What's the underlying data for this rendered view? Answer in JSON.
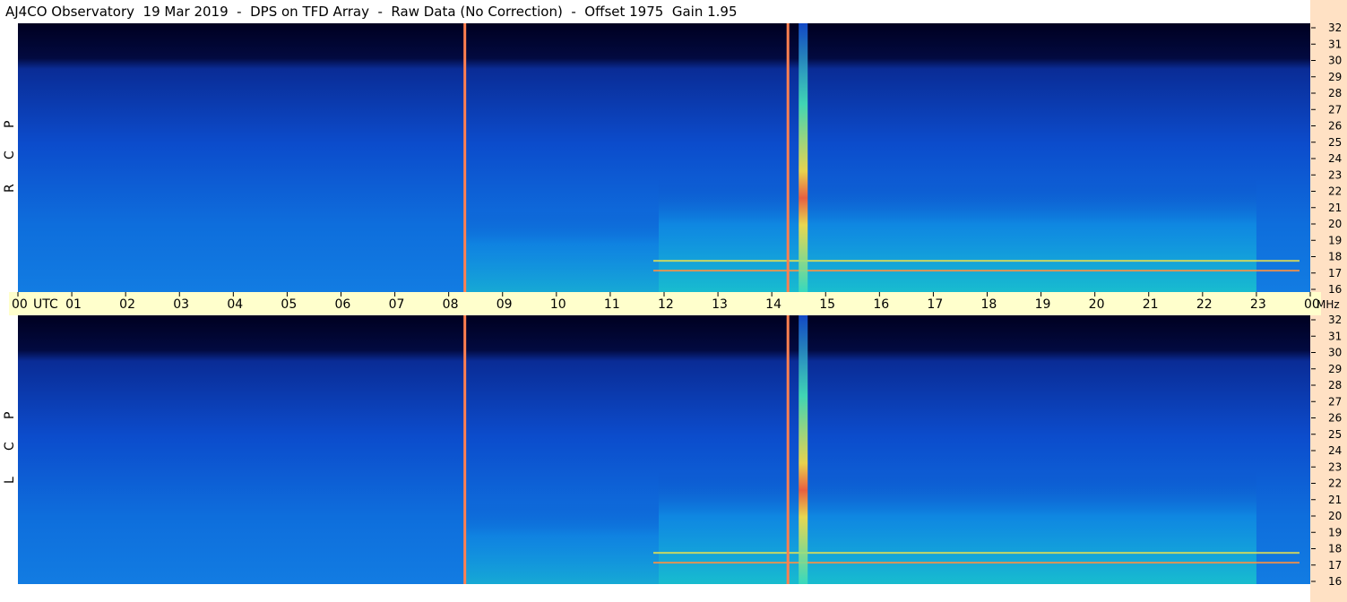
{
  "title": "AJ4CO Observatory  19 Mar 2019  -  DPS on TFD Array  -  Raw Data (No Correction)  -  Offset 1975  Gain 1.95",
  "time_axis": {
    "labels": [
      "00",
      "01",
      "02",
      "03",
      "04",
      "05",
      "06",
      "07",
      "08",
      "09",
      "10",
      "11",
      "12",
      "13",
      "14",
      "15",
      "16",
      "17",
      "18",
      "19",
      "20",
      "21",
      "22",
      "23",
      "00"
    ],
    "utc_label": "UTC"
  },
  "freq_axis": {
    "labels": [
      32,
      31,
      30,
      29,
      28,
      27,
      26,
      25,
      24,
      23,
      22,
      21,
      20,
      19,
      18,
      17,
      16
    ],
    "unit": "MHz"
  },
  "panels": [
    {
      "polarization": [
        "R",
        "C",
        "P"
      ]
    },
    {
      "polarization": [
        "L",
        "C",
        "P"
      ]
    }
  ],
  "colors": {
    "background": "#ffffff",
    "time_strip": "#ffffcc",
    "freq_column": "#ffe1c4",
    "spectrogram_low": "#000030",
    "spectrogram_mid": "#0a5ad2",
    "spectrogram_high": "#14d2c3",
    "interference_line": "#ff8050"
  },
  "chart_data": {
    "type": "heatmap",
    "title": "AJ4CO Observatory  19 Mar 2019  -  DPS on TFD Array  -  Raw Data (No Correction)  -  Offset 1975  Gain 1.95",
    "x_unit": "UTC hour",
    "y_unit": "MHz",
    "xlim": [
      0,
      24
    ],
    "ylim": [
      16,
      32
    ],
    "panels": [
      "RCP",
      "LCP"
    ],
    "vertical_interference_lines_utc": [
      8.3,
      14.3
    ],
    "strong_broadband_emission_utc": [
      14.5,
      14.6
    ],
    "strong_emission_freq_range_mhz": [
      20,
      26
    ]
  }
}
